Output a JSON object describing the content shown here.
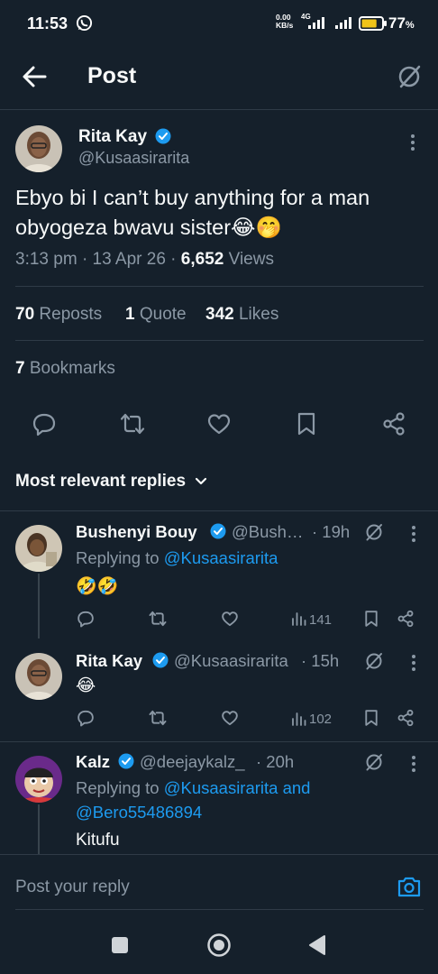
{
  "status_bar": {
    "time": "11:53",
    "net_speed_value": "0.00",
    "net_speed_unit": "KB/s",
    "net_type": "4G",
    "battery_percent": "77",
    "battery_unit": "%",
    "battery_level": 0.77
  },
  "header": {
    "title": "Post"
  },
  "tweet": {
    "author_name": "Rita Kay",
    "author_handle": "@Kusaasirarita",
    "text_line1": "Ebyo bi I can’t buy anything for a man",
    "text_line2": "obyogeza bwavu sister😂🤭",
    "time": "3:13 pm",
    "sep": "·",
    "date": "13 Apr 26",
    "views_count": "6,652",
    "views_label": "Views",
    "reposts_count": "70",
    "reposts_label": "Reposts",
    "quotes_count": "1",
    "quotes_label": "Quote",
    "likes_count": "342",
    "likes_label": "Likes",
    "bookmarks_count": "7",
    "bookmarks_label": "Bookmarks"
  },
  "sort": {
    "label": "Most relevant replies"
  },
  "replies": [
    {
      "name": "Bushenyi Bouy",
      "handle": "@Bush…",
      "time": "· 19h",
      "replying_prefix": "Replying to",
      "replying_to": "@Kusaasirarita",
      "text": "🤣🤣",
      "views": "141"
    },
    {
      "name": "Rita Kay",
      "handle": "@Kusaasirarita",
      "time": "· 15h",
      "text": "😂",
      "views": "102"
    },
    {
      "name": "Kalz",
      "handle": "@deejaykalz_",
      "time": "· 20h",
      "replying_prefix": "Replying to",
      "replying_to": "@Kusaasirarita and",
      "replying_to2": "@Bero55486894",
      "text": "Kitufu"
    }
  ],
  "reply_bar": {
    "placeholder": "Post your reply"
  },
  "colors": {
    "background": "#15202b",
    "accent": "#1d9bf0",
    "muted": "#8b98a5",
    "divider": "#2f3b47"
  },
  "icons": [
    "whatsapp-icon",
    "back-arrow-icon",
    "grok-icon",
    "verified-icon",
    "more-icon",
    "reply-icon",
    "repost-icon",
    "like-icon",
    "bookmark-icon",
    "share-icon",
    "views-icon",
    "chevron-down-icon",
    "camera-icon"
  ]
}
